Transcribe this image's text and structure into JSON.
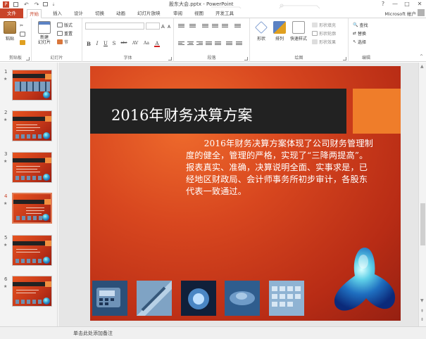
{
  "title_bar": {
    "doc_title": "股东大会.pptx - PowerPoint",
    "window_controls": [
      "?",
      "—",
      "□",
      "✕"
    ]
  },
  "tabs": {
    "file": "文件",
    "items": [
      "开始",
      "插入",
      "设计",
      "切换",
      "动画",
      "幻灯片放映",
      "审阅",
      "视图",
      "开发工具"
    ],
    "active": "开始",
    "account": "Microsoft 帐户"
  },
  "ribbon": {
    "clipboard": {
      "paste": "粘贴",
      "label": "剪贴板"
    },
    "slides": {
      "new_slide": "新建\n幻灯片",
      "layout": "版式",
      "reset": "重置",
      "section": "节",
      "label": "幻灯片"
    },
    "font": {
      "label": "字体",
      "format_buttons": [
        "B",
        "I",
        "U",
        "S",
        "abc",
        "AV",
        "Aa",
        "A"
      ]
    },
    "paragraph": {
      "label": "段落"
    },
    "drawing": {
      "shape": "形状",
      "arrange": "排列",
      "quick_styles": "快速样式",
      "fill": "形状填充",
      "outline": "形状轮廓",
      "effects": "形状效果",
      "label": "绘图"
    },
    "editing": {
      "find": "查找",
      "replace": "替换",
      "select": "选择",
      "label": "编辑"
    }
  },
  "thumbnails": {
    "numbers": [
      "1",
      "2",
      "3",
      "4",
      "5",
      "6"
    ],
    "star": "★",
    "active_index": 4
  },
  "slide": {
    "title": "2016年财务决算方案",
    "body": "2016年财务决算方案体现了公司财务管理制度的健全，管理的严格，实现了“三降两提高”。报表真实、准确，决算说明全面、实事求是，已经地区财政局、会计师事务所初步审计，各股东代表一致通过。"
  },
  "status": {
    "notes_hint": "单击此处添加备注"
  },
  "colors": {
    "accent": "#c9442a",
    "title_band": "#222222",
    "title_accent": "#ef7d2a"
  }
}
